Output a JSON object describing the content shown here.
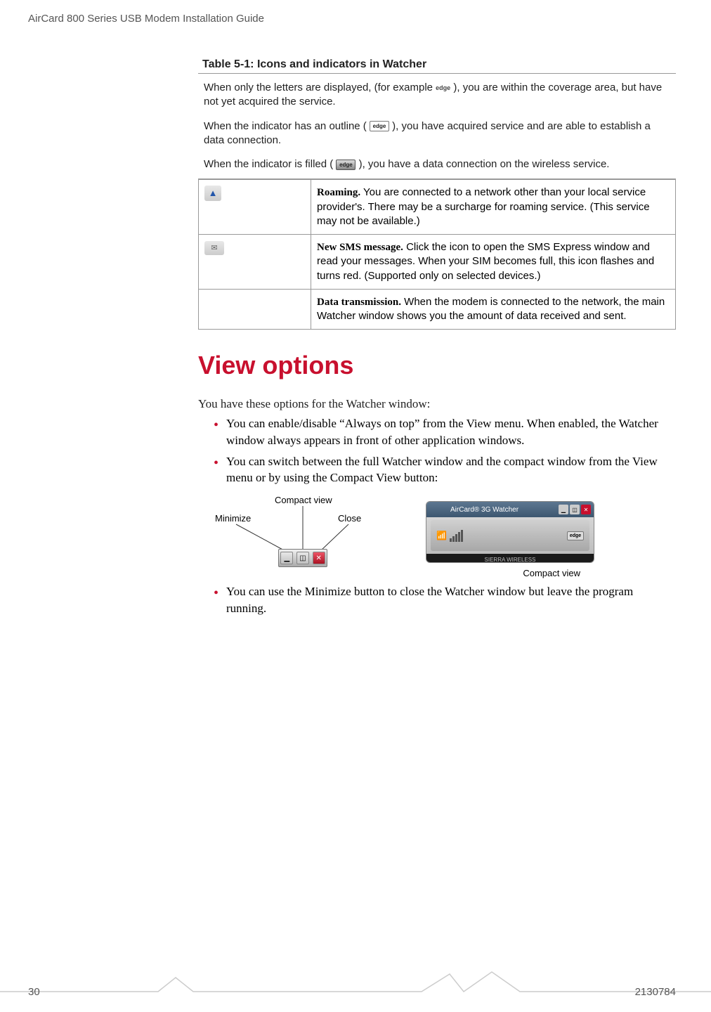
{
  "header": {
    "title": "AirCard 800 Series USB Modem Installation Guide"
  },
  "table": {
    "title": "Table 5-1: Icons and indicators in Watcher",
    "intro": {
      "p1_pre": "When only the letters are displayed, (for example ",
      "p1_post": "), you are within the coverage area, but have not yet acquired the service.",
      "p2_pre": "When the indicator has an outline (",
      "p2_post": "), you have acquired service and are able to establish a data connection.",
      "p3_pre": "When the indicator is filled (",
      "p3_post": "), you have a data connection on the wireless service."
    },
    "rows": [
      {
        "icon": "roaming-icon",
        "bold": "Roaming.",
        "text": " You are connected to a network other than your local service provider's. There may be a surcharge for roaming service. (This service may not be available.)"
      },
      {
        "icon": "sms-icon",
        "bold": "New SMS message.",
        "text": " Click the icon to open the SMS Express window and read your messages. When your SIM becomes full, this icon flashes and turns red. (Supported only on selected devices.)"
      },
      {
        "icon": "",
        "bold": "Data transmission.",
        "text": " When the modem is connected to the network, the main Watcher window shows you the amount of data received and sent."
      }
    ]
  },
  "section": {
    "heading": "View options",
    "intro": "You have these options for the Watcher window:",
    "bullets": [
      "You can enable/disable “Always on top” from the View menu. When enabled, the Watcher window always appears in front of other application windows.",
      "You can switch between the full Watcher window and the compact window from the View menu or by using the Compact View button:",
      "You can use the Minimize button to close the Watcher window but leave the program running."
    ],
    "diagram": {
      "minimize_label": "Minimize",
      "compact_label": "Compact view",
      "close_label": "Close",
      "compact_view_caption": "Compact view",
      "app_title": "AirCard® 3G Watcher",
      "footer_brand": "SIERRA WIRELESS"
    }
  },
  "footer": {
    "page_number": "30",
    "doc_id": "2130784"
  }
}
